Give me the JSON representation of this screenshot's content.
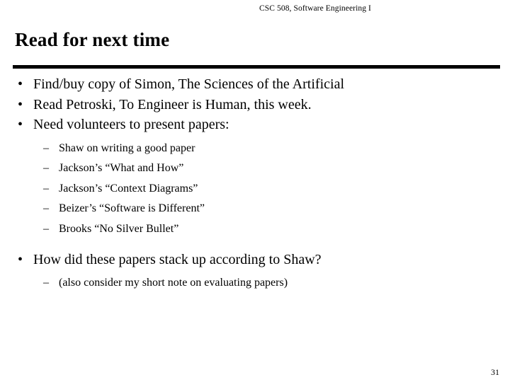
{
  "slide": {
    "header": "CSC 508, Software Engineering I",
    "title": "Read for next time",
    "page_number": "31",
    "bullet_marker": "•",
    "dash_marker": "–",
    "bullets": [
      {
        "level": 1,
        "text": "Find/buy copy of Simon, The Sciences of the Artificial"
      },
      {
        "level": 1,
        "text": "Read Petroski, To Engineer is Human, this week."
      },
      {
        "level": 1,
        "text": "Need volunteers to present papers:"
      },
      {
        "level": 2,
        "text": "Shaw on writing a good paper"
      },
      {
        "level": 2,
        "text": "Jackson’s “What and How”"
      },
      {
        "level": 2,
        "text": "Jackson’s “Context Diagrams”"
      },
      {
        "level": 2,
        "text": "Beizer’s “Software is Different”"
      },
      {
        "level": 2,
        "text": "Brooks “No Silver Bullet”"
      },
      {
        "level": 1,
        "text": "How did these papers stack up according to Shaw?"
      },
      {
        "level": 2,
        "text": "(also consider my short note on evaluating papers)"
      }
    ]
  }
}
